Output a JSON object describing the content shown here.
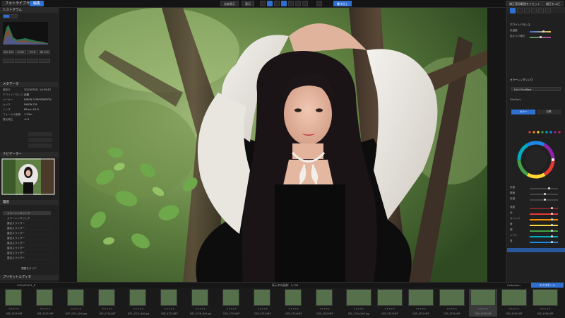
{
  "tabs": {
    "library": "フォトライブラリ",
    "edit": "編集"
  },
  "toolbar": {
    "btn1": "比較表示",
    "btn2": "表示",
    "right1": "補正適用範囲をリセット",
    "right2": "補正をコピー",
    "export_top": "書き出し"
  },
  "left": {
    "histogram_title": "ヒストグラム",
    "values": [
      "ISO 100",
      "1/125",
      "f/2.8",
      "85 mm"
    ],
    "metadata_title": "メタデータ",
    "meta_rows": [
      {
        "k": "撮影日",
        "v": "2023/05/21 14:03:42"
      },
      {
        "k": "ホワイトバランス",
        "v": "自動"
      },
      {
        "k": "メーカー",
        "v": "NIKON CORPORATION"
      },
      {
        "k": "カメラ",
        "v": "NIKON Z 8"
      },
      {
        "k": "レンズ",
        "v": "85mm f/1.8"
      },
      {
        "k": "フォーカス距離",
        "v": "1.23m"
      },
      {
        "k": "露出補正",
        "v": "-0.3"
      }
    ],
    "nav_title": "ナビゲーター",
    "history_title": "履歴",
    "history_items": [
      "カラーレンダリング",
      "カラーレンダリング",
      "露出スライダー",
      "露出スライダー",
      "露出スライダー",
      "露出スライダー",
      "露出スライダー",
      "露出スライダー",
      "露出スライダー",
      "露出スライダー"
    ],
    "history_clear": "履歴をクリア",
    "presets_title": "プリセットエディタ"
  },
  "right": {
    "section1": "ホワイトバランス",
    "row_temp": "色温度",
    "row_tint": "色かぶり補正",
    "section2": "カラーレンダリング",
    "row_profile": "DxO PureRaw",
    "section3": "FilmPack",
    "btn_a": "カラー",
    "btn_b": "白黒",
    "colorwheel_label": "カラーホイール",
    "sliders": [
      "彩度",
      "輝度",
      "色相",
      "強度",
      "赤",
      "オレンジ",
      "黄",
      "緑",
      "シアン",
      "青"
    ]
  },
  "filmstrip_bar": {
    "path": "2023/05/21_R",
    "count": "表示中の画像：1,234",
    "collection": "Collection",
    "export": "エクスポート"
  },
  "thumbs": [
    {
      "fn": "DSF_4703.NEF"
    },
    {
      "fn": "DSF_4707.NEF"
    },
    {
      "fn": "DSF_4711_DxO.jpg"
    },
    {
      "fn": "DSF_4716.NEF"
    },
    {
      "fn": "DSF_4719_DxO.jpg"
    },
    {
      "fn": "DSF_4723.NEF"
    },
    {
      "fn": "DSF_4726_DxO.jpg"
    },
    {
      "fn": "DSF_4729.NEF"
    },
    {
      "fn": "DSF_4731.NEF"
    },
    {
      "fn": "DSF_4734.NEF"
    },
    {
      "fn": "DSF_4740.NEF"
    },
    {
      "fn": "DSF_4744_DxO.jpg"
    },
    {
      "fn": "DSF_4747.NEF"
    },
    {
      "fn": "DSF_4751.NEF"
    },
    {
      "fn": "DSF_4755.NEF"
    },
    {
      "fn": "DSF_4759.NEF"
    },
    {
      "fn": "DSF_4762.NEF"
    },
    {
      "fn": "DSF_4766.NEF"
    },
    {
      "fn": "DSF_4770.NEF"
    }
  ],
  "colors": {
    "accent": "#2f6fd0",
    "panel": "#202020",
    "bg": "#161616"
  }
}
